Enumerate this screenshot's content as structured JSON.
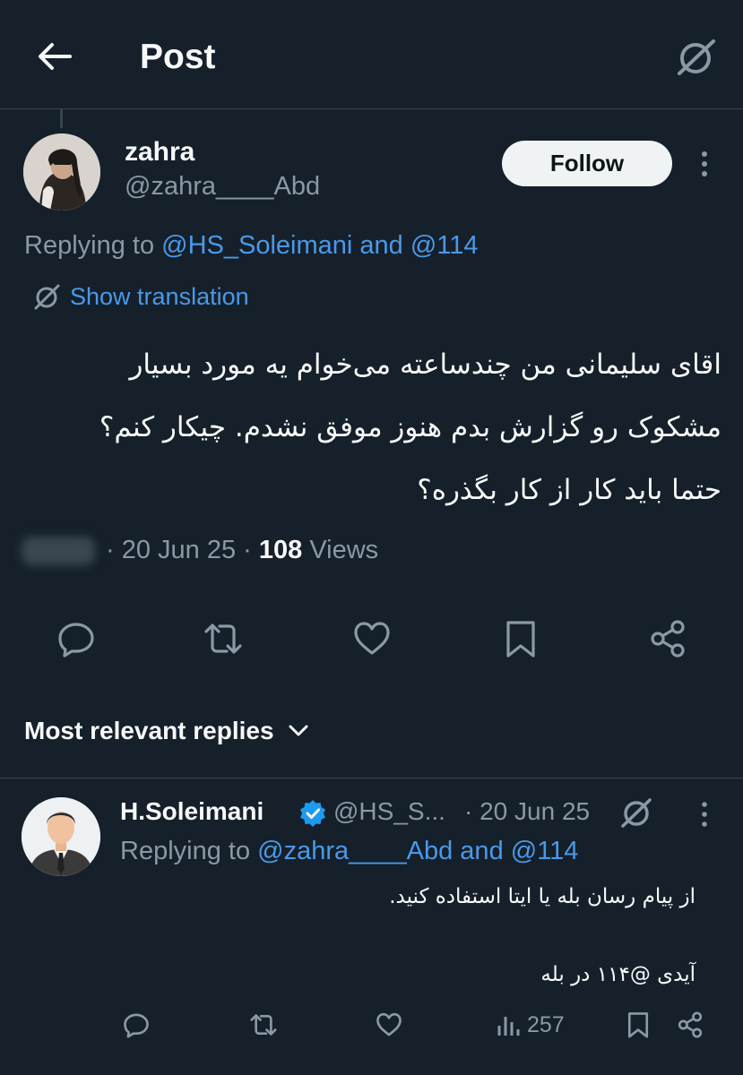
{
  "header": {
    "title": "Post",
    "back_icon": "arrow-left-icon",
    "grok_icon": "grok-icon"
  },
  "post": {
    "author_name": "zahra",
    "author_handle": "@zahra____Abd",
    "follow_label": "Follow",
    "replying_prefix": "Replying to ",
    "replying_to": "@HS_Soleimani and @114",
    "show_translation": "Show translation",
    "body_lines": [
      "اقای سلیمانی من چندساعته می‌خوام یه مورد بسیار",
      "مشکوک رو گزارش بدم هنوز موفق نشدم. چیکار کنم؟",
      "حتما باید کار از کار بگذره؟"
    ],
    "date": "· 20 Jun 25 ·",
    "views_count": "108",
    "views_label": "Views"
  },
  "actions": [
    "reply-icon",
    "retweet-icon",
    "like-icon",
    "bookmark-icon",
    "share-icon"
  ],
  "replies_header": {
    "label": "Most relevant replies"
  },
  "reply": {
    "author_name": "H.Soleimani",
    "author_handle": "@HS_S...",
    "date": "· 20 Jun 25",
    "replying_prefix": "Replying to ",
    "replying_to": "@zahra____Abd and @114",
    "body_line1": "از پیام رسان بله یا ایتا استفاده کنید.",
    "body_line2": "آیدی @۱۱۴ در بله",
    "views_count": "257"
  },
  "colors": {
    "background": "#15202b",
    "text": "#f7f9f9",
    "muted": "#8b98a5",
    "link": "#4a99e9",
    "verified": "#1d9bf0",
    "divider": "#38444d"
  }
}
